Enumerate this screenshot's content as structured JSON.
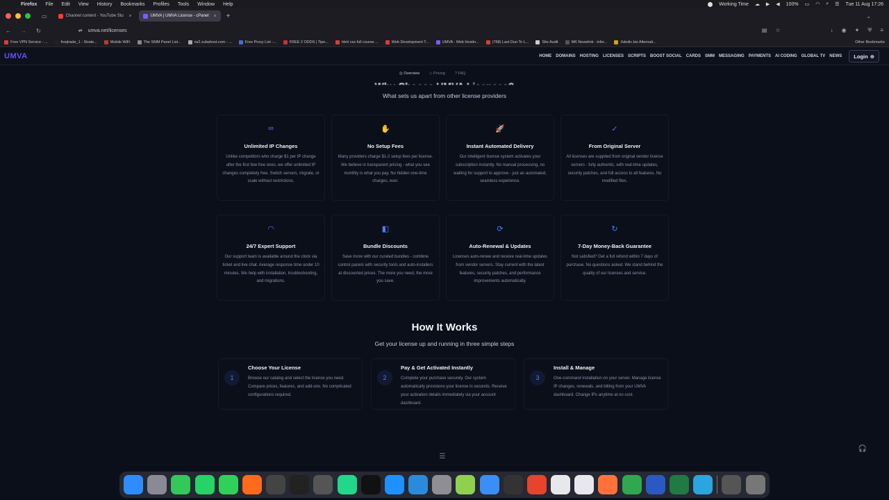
{
  "menubar": {
    "app": "Firefox",
    "items": [
      "File",
      "Edit",
      "View",
      "History",
      "Bookmarks",
      "Profiles",
      "Tools",
      "Window",
      "Help"
    ],
    "status_label": "Working Time",
    "battery": "100%",
    "clock": "Tue 11 Aug 17:26"
  },
  "tabs": [
    {
      "title": "Channel content - YouTube Stu",
      "color": "#ff3b30",
      "active": false
    },
    {
      "title": "UMVA | UMVA License - cPanel",
      "color": "#7b5cff",
      "active": true
    }
  ],
  "url": "umva.net/licenses",
  "bookmarks": [
    {
      "label": "Free VPN Service - ...",
      "color": "#e23b3b"
    },
    {
      "label": "freqtrade_1 - Strate...",
      "color": "#222"
    },
    {
      "label": "Mobile WiFi",
      "color": "#c0392b"
    },
    {
      "label": "The SMM Panel List...",
      "color": "#888"
    },
    {
      "label": "ns2.zubahost.com - ...",
      "color": "#aaa"
    },
    {
      "label": "Free Proxy List -...",
      "color": "#3e6fd8"
    },
    {
      "label": "FREE 2 ODDS | Tipe...",
      "color": "#d32f2f"
    },
    {
      "label": "html css full course ...",
      "color": "#e53935"
    },
    {
      "label": "Web Development T...",
      "color": "#e53935"
    },
    {
      "label": "UMVA - Web Hostin...",
      "color": "#7b5cff"
    },
    {
      "label": "(768) Last Duo To L...",
      "color": "#e53935"
    },
    {
      "label": "Site Audit",
      "color": "#ccc"
    },
    {
      "label": "MK Newslink - infor...",
      "color": "#555"
    },
    {
      "label": "Xdedic.biz Alternati...",
      "color": "#d9a400"
    }
  ],
  "other_bookmarks": "Other Bookmarks",
  "site": {
    "logo": "UMVA",
    "nav": [
      "HOME",
      "DOMAINS",
      "HOSTING",
      "LICENSES",
      "SCRIPTS",
      "BOOST SOCIAL",
      "CARDS",
      "SMM",
      "MESSAGING",
      "PAYMENTS",
      "AI CODING",
      "GLOBAL TV",
      "NEWS"
    ],
    "login": "Login"
  },
  "subtabs": [
    "Overview",
    "Pricing",
    "FAQ"
  ],
  "why": {
    "title": "Why Choose UMVA Licenses?",
    "subtitle": "What sets us apart from other license providers"
  },
  "features": [
    {
      "icon": "infinity-icon",
      "glyph": "∞",
      "title": "Unlimited IP Changes",
      "desc": "Unlike competitors who charge $1 per IP change after the first few free ones, we offer unlimited IP changes completely free. Switch servers, migrate, or scale without restrictions."
    },
    {
      "icon": "hand-coin-icon",
      "glyph": "✋",
      "title": "No Setup Fees",
      "desc": "Many providers charge $1-2 setup fees per license. We believe in transparent pricing - what you see monthly is what you pay. No hidden one-time charges, ever."
    },
    {
      "icon": "rocket-icon",
      "glyph": "🚀",
      "title": "Instant Automated Delivery",
      "desc": "Our intelligent license system activates your subscription instantly. No manual processing, no waiting for support to approve - just an automated, seamless experience."
    },
    {
      "icon": "check-circle-icon",
      "glyph": "✓",
      "title": "From Original Server",
      "desc": "All licenses are supplied from original vendor license servers - fully authentic, with real-time updates, security patches, and full access to all features. No modified files."
    },
    {
      "icon": "headset-icon",
      "glyph": "◠",
      "title": "24/7 Expert Support",
      "desc": "Our support team is available around the clock via ticket and live chat. Average response time under 10 minutes. We help with installation, troubleshooting, and migrations."
    },
    {
      "icon": "shopping-bag-icon",
      "glyph": "◧",
      "title": "Bundle Discounts",
      "desc": "Save more with our curated bundles - combine control panels with security tools and auto-installers at discounted prices. The more you need, the more you save."
    },
    {
      "icon": "refresh-icon",
      "glyph": "⟳",
      "title": "Auto-Renewal & Updates",
      "desc": "Licenses auto-renew and receive real-time updates from vendor servers. Stay current with the latest features, security patches, and performance improvements automatically."
    },
    {
      "icon": "money-back-icon",
      "glyph": "↻",
      "title": "7-Day Money-Back Guarantee",
      "desc": "Not satisfied? Get a full refund within 7 days of purchase. No questions asked. We stand behind the quality of our licenses and service."
    }
  ],
  "how": {
    "title": "How It Works",
    "subtitle": "Get your license up and running in three simple steps",
    "steps": [
      {
        "num": "1",
        "title": "Choose Your License",
        "desc": "Browse our catalog and select the license you need. Compare prices, features, and add-ons. No complicated configurations required."
      },
      {
        "num": "2",
        "title": "Pay & Get Activated Instantly",
        "desc": "Complete your purchase securely. Our system automatically provisions your license in seconds. Receive your activation details immediately via your account dashboard."
      },
      {
        "num": "3",
        "title": "Install & Manage",
        "desc": "One-command installation on your server. Manage license IP changes, renewals, and billing from your UMVA dashboard. Change IPs anytime at no cost."
      }
    ]
  },
  "dock": [
    {
      "name": "finder",
      "color": "#2d8cff"
    },
    {
      "name": "launchpad",
      "color": "#8a8a96"
    },
    {
      "name": "messages",
      "color": "#34c759"
    },
    {
      "name": "whatsapp",
      "color": "#25d366"
    },
    {
      "name": "facetime",
      "color": "#30d158"
    },
    {
      "name": "firefox-dev",
      "color": "#ff6a1c"
    },
    {
      "name": "chatgpt",
      "color": "#444"
    },
    {
      "name": "terminal",
      "color": "#222"
    },
    {
      "name": "textedit",
      "color": "#555"
    },
    {
      "name": "pycharm",
      "color": "#21d789"
    },
    {
      "name": "unity",
      "color": "#111"
    },
    {
      "name": "app-store",
      "color": "#1e90ff"
    },
    {
      "name": "vscode",
      "color": "#2a8bdc"
    },
    {
      "name": "settings",
      "color": "#8e8e93"
    },
    {
      "name": "notes-app",
      "color": "#8fd14f"
    },
    {
      "name": "mail",
      "color": "#3a8ef6"
    },
    {
      "name": "piano",
      "color": "#333"
    },
    {
      "name": "browser-orange",
      "color": "#e8432b"
    },
    {
      "name": "blank-1",
      "color": "#e8e8ec"
    },
    {
      "name": "blank-2",
      "color": "#e8e8ec"
    },
    {
      "name": "firefox",
      "color": "#ff7139"
    },
    {
      "name": "stocks",
      "color": "#2fa84f"
    },
    {
      "name": "stack",
      "color": "#2b59c3"
    },
    {
      "name": "excel",
      "color": "#1f7a43"
    },
    {
      "name": "telegram",
      "color": "#2aa5e0"
    },
    {
      "name": "downloads",
      "color": "#555"
    },
    {
      "name": "trash",
      "color": "#777"
    }
  ]
}
